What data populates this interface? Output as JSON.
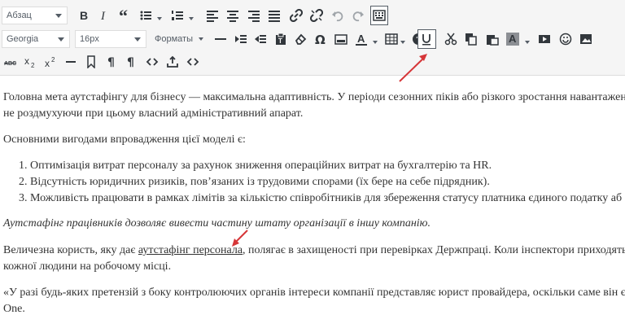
{
  "toolbar": {
    "format_select": "Абзац",
    "font_family_select": "Georgia",
    "font_size_select": "16px",
    "formats_select": "Форматы"
  },
  "icons": {
    "row1": [
      "bold-icon",
      "italic-icon",
      "blockquote-icon",
      "bullet-list-icon",
      "numbered-list-icon",
      "align-left-icon",
      "align-center-icon",
      "align-right-icon",
      "align-justify-icon",
      "link-icon",
      "unlink-icon",
      "undo-icon",
      "redo-icon",
      "keyboard-toggle-icon"
    ],
    "row2": [
      "horizontal-rule-icon",
      "indent-icon",
      "outdent-icon",
      "paste-text-icon",
      "clear-formatting-icon",
      "omega-icon",
      "image-icon",
      "text-color-icon",
      "table-icon",
      "help-icon",
      "underline-icon",
      "cut-icon",
      "copy-icon",
      "paste-icon",
      "background-color-icon",
      "media-icon",
      "emoticons-icon",
      "picture-icon"
    ],
    "row3": [
      "strikethrough-icon",
      "subscript-icon",
      "superscript-icon",
      "horizontal-line-icon",
      "bookmark-icon",
      "paragraph-icon",
      "show-blocks-icon",
      "code-icon",
      "insert-icon",
      "source-code-icon"
    ]
  },
  "highlight_color": "#d63638",
  "content": {
    "p1_line1": "Головна мета аутстафінгу для бізнесу — максимальна адаптивність. У періоди сезонних піків або різкого зростання навантажен",
    "p1_line2": "не роздмухуючи при цьому власний адміністративний апарат.",
    "p2": "Основними вигодами впровадження цієї моделі є:",
    "list": [
      "Оптимізація витрат персоналу за рахунок зниження операційних витрат на бухгалтерію та HR.",
      "Відсутність юридичних ризиків, пов’язаних із трудовими спорами (їх бере на себе підрядник).",
      "Можливість працювати в рамках лімітів за кількістю співробітників для збереження статусу платника єдиного податку аб"
    ],
    "list_numbers": [
      "1.",
      "2.",
      "3."
    ],
    "italic_p": "Аутстафінг працівників дозволяє вивести частину штату організації в іншу компанію.",
    "p4_before": "Величезна користь, яку дає ",
    "p4_link": "аутстафінг персонала",
    "p4_after": ", полягає в захищеності при перевірках Держпраці. Коли інспектори приходять",
    "p4_line2": "кожної людини на робочому місці.",
    "p5_line1": "«У разі будь-яких претензій з боку контролюючих органів інтереси компанії представляє юрист провайдера, оскільки саме він є",
    "p5_line2": "One."
  }
}
